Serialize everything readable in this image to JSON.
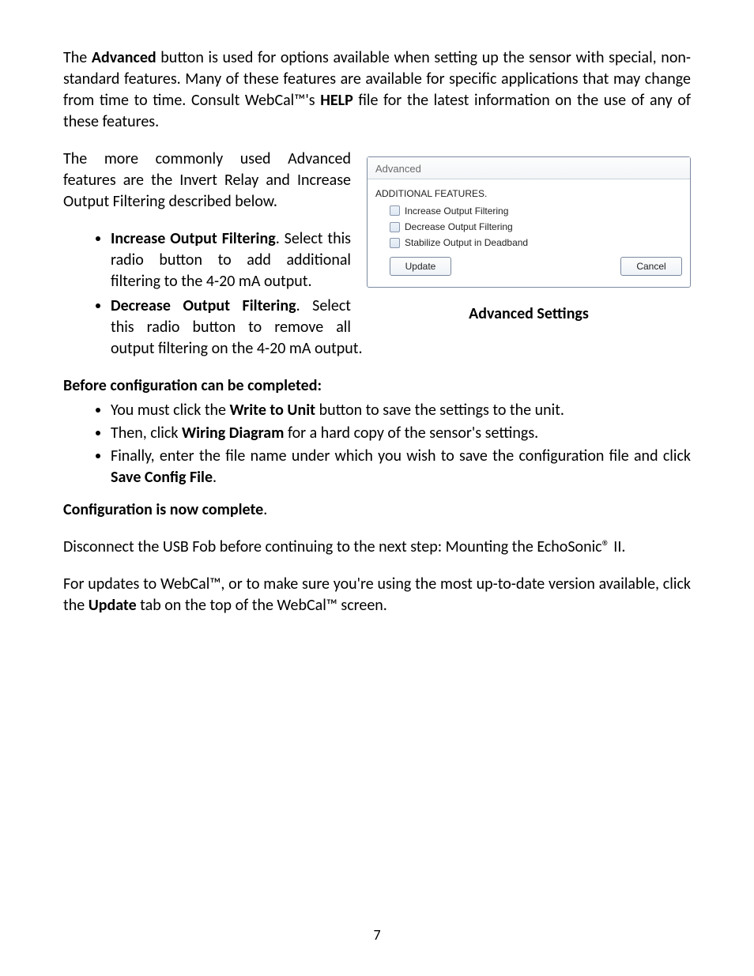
{
  "para1": {
    "t1": "The ",
    "b1": "Advanced",
    "t2": " button is used for options available when setting up the sensor with special, non-standard features.  Many of these features are available for specific applications that may change from time to time.  Consult WebCal™'s ",
    "b2": "HELP",
    "t3": " file for the latest information on the use of any of these features."
  },
  "para2": "The more commonly used Advanced features are the Invert Relay and Increase Output Filtering described below.",
  "bullets1": {
    "item1_b": "Increase Output Filtering",
    "item1_t": ". Select this radio button to add additional filtering to the 4-20 mA output.",
    "item2_b": "Decrease Output Filtering",
    "item2_t": ". Select this radio button to remove all output filtering on the 4-20 mA output."
  },
  "heading1": "Before configuration can be completed:",
  "bullets2": {
    "i1_t1": "You must click the ",
    "i1_b": "Write to Unit",
    "i1_t2": " button to save the settings to the unit.",
    "i2_t1": "Then, click ",
    "i2_b": "Wiring Diagram",
    "i2_t2": " for a hard copy of the sensor's settings.",
    "i3_t1": "Finally, enter the file name under which you wish to save the configuration file and click ",
    "i3_b": "Save Config File",
    "i3_t2": "."
  },
  "heading2_b": "Configuration is now complete",
  "heading2_t": ".",
  "para3": "Disconnect the USB Fob before continuing to the next step: Mounting the EchoSonic® II.",
  "para4": {
    "t1": "For updates to WebCal™, or to make sure you're using the most up-to-date version available, click the ",
    "b": "Update",
    "t2": " tab on the top of the WebCal™ screen."
  },
  "dialog": {
    "title": "Advanced",
    "subtitle": "ADDITIONAL FEATURES.",
    "chk1": "Increase Output Filtering",
    "chk2": "Decrease Output Filtering",
    "chk3": "Stabilize Output in Deadband",
    "update": "Update",
    "cancel": "Cancel"
  },
  "caption": "Advanced Settings",
  "page_number": "7"
}
